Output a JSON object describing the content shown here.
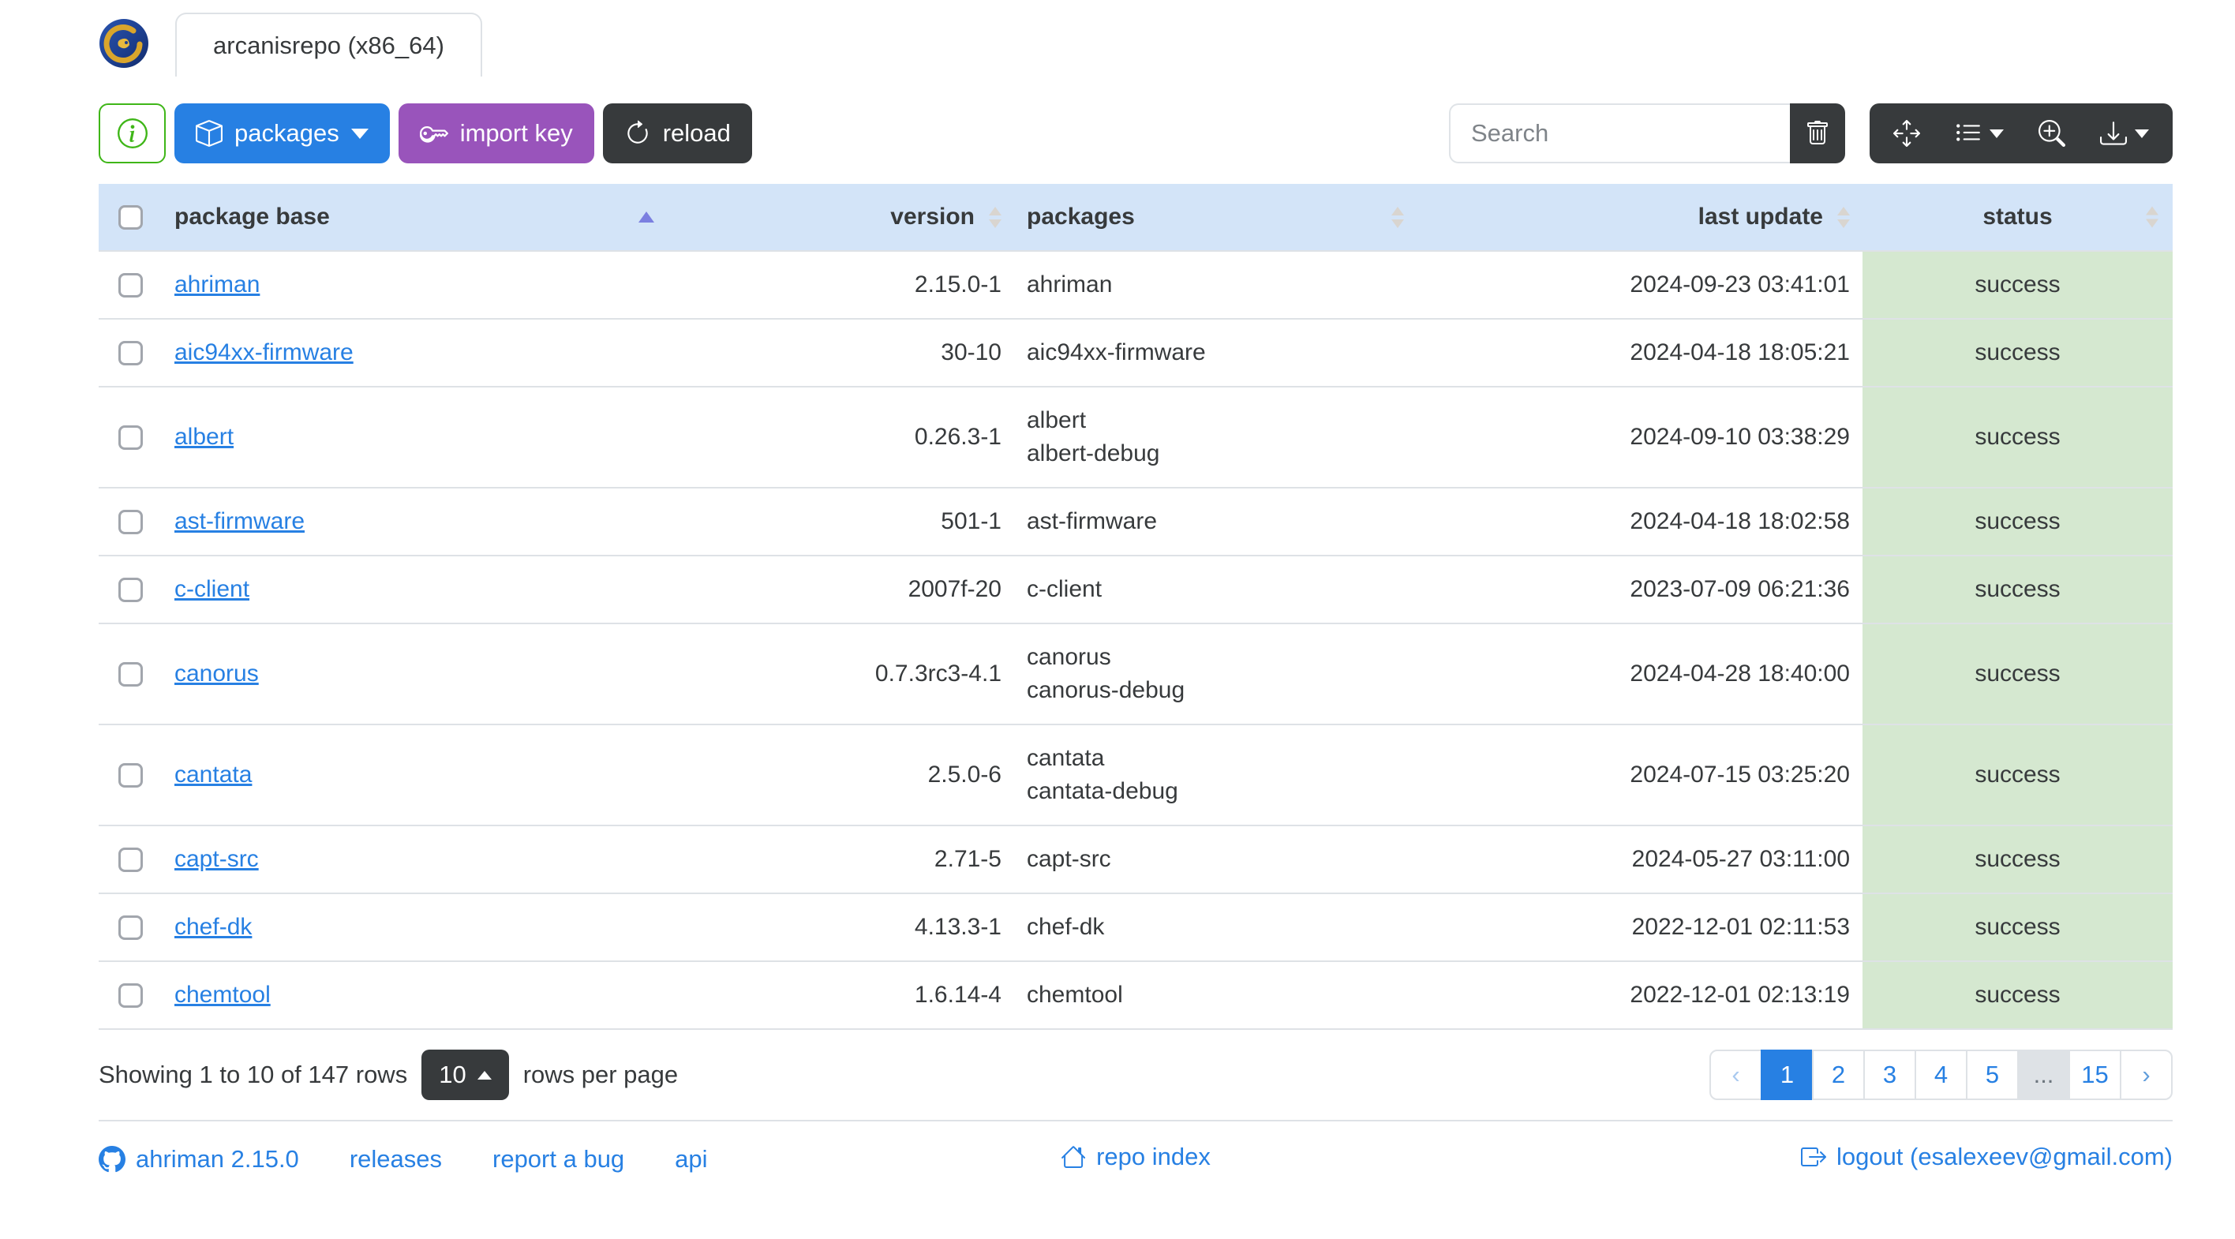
{
  "colors": {
    "primary": "#2780e3",
    "purple": "#9954bb",
    "dark": "#373a3c",
    "success-border": "#3fb618",
    "table-header-bg": "#d3e4f8",
    "status-bg": "#d5e8d0",
    "border": "#dee2e6",
    "sort-active": "#7b7fe0",
    "sort-inactive": "#d9d5d0",
    "link": "#2780e3"
  },
  "window": {
    "tab_title": "arcanisrepo (x86_64)",
    "logo_icon": "ahriman-dragon-logo"
  },
  "toolbar": {
    "info_icon": "info-circle-icon",
    "packages_label": "packages",
    "import_key_label": "import key",
    "reload_label": "reload",
    "search_placeholder": "Search",
    "trash_icon": "trash-icon",
    "fullscreen_icon": "arrows-move-icon",
    "columns_icon": "list-icon",
    "advanced_search_icon": "zoom-in-icon",
    "export_icon": "download-icon"
  },
  "table": {
    "headers": {
      "base": "package base",
      "version": "version",
      "packages": "packages",
      "last_update": "last update",
      "status": "status"
    },
    "sort": {
      "column": "package base",
      "direction": "asc"
    },
    "rows": [
      {
        "base": "ahriman",
        "version": "2.15.0-1",
        "packages": [
          "ahriman"
        ],
        "last_update": "2024-09-23 03:41:01",
        "status": "success"
      },
      {
        "base": "aic94xx-firmware",
        "version": "30-10",
        "packages": [
          "aic94xx-firmware"
        ],
        "last_update": "2024-04-18 18:05:21",
        "status": "success"
      },
      {
        "base": "albert",
        "version": "0.26.3-1",
        "packages": [
          "albert",
          "albert-debug"
        ],
        "last_update": "2024-09-10 03:38:29",
        "status": "success"
      },
      {
        "base": "ast-firmware",
        "version": "501-1",
        "packages": [
          "ast-firmware"
        ],
        "last_update": "2024-04-18 18:02:58",
        "status": "success"
      },
      {
        "base": "c-client",
        "version": "2007f-20",
        "packages": [
          "c-client"
        ],
        "last_update": "2023-07-09 06:21:36",
        "status": "success"
      },
      {
        "base": "canorus",
        "version": "0.7.3rc3-4.1",
        "packages": [
          "canorus",
          "canorus-debug"
        ],
        "last_update": "2024-04-28 18:40:00",
        "status": "success"
      },
      {
        "base": "cantata",
        "version": "2.5.0-6",
        "packages": [
          "cantata",
          "cantata-debug"
        ],
        "last_update": "2024-07-15 03:25:20",
        "status": "success"
      },
      {
        "base": "capt-src",
        "version": "2.71-5",
        "packages": [
          "capt-src"
        ],
        "last_update": "2024-05-27 03:11:00",
        "status": "success"
      },
      {
        "base": "chef-dk",
        "version": "4.13.3-1",
        "packages": [
          "chef-dk"
        ],
        "last_update": "2022-12-01 02:11:53",
        "status": "success"
      },
      {
        "base": "chemtool",
        "version": "1.6.14-4",
        "packages": [
          "chemtool"
        ],
        "last_update": "2022-12-01 02:13:19",
        "status": "success"
      }
    ]
  },
  "pagination": {
    "summary": "Showing 1 to 10 of 147 rows",
    "page_size": "10",
    "rows_per_page_label": "rows per page",
    "prev_label": "‹",
    "next_label": "›",
    "pages": [
      "1",
      "2",
      "3",
      "4",
      "5",
      "...",
      "15"
    ],
    "active_page": "1"
  },
  "footer": {
    "version_link": "ahriman 2.15.0",
    "releases_link": "releases",
    "report_bug_link": "report a bug",
    "api_link": "api",
    "repo_index_link": "repo index",
    "logout_link": "logout (esalexeev@gmail.com)"
  }
}
